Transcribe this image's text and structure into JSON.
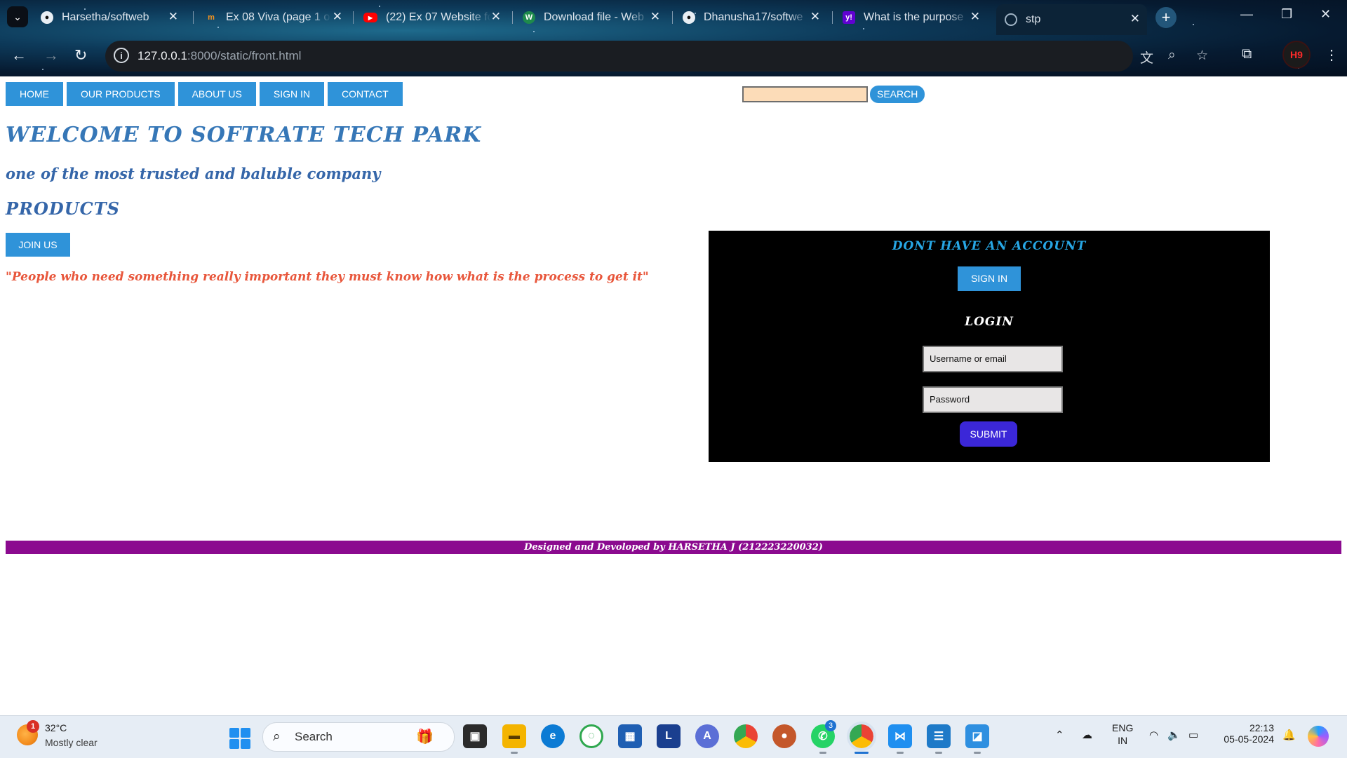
{
  "browser": {
    "tabs": [
      {
        "title": "Harsetha/softweb",
        "favicon": "github-icon",
        "active": false
      },
      {
        "title": "Ex 08 Viva (page 1 of",
        "favicon": "moodle-icon",
        "active": false
      },
      {
        "title": "(22) Ex 07 Website fo",
        "favicon": "youtube-icon",
        "active": false
      },
      {
        "title": "Download file - Web",
        "favicon": "w-icon",
        "active": false
      },
      {
        "title": "Dhanusha17/softwe",
        "favicon": "github-icon",
        "active": false
      },
      {
        "title": "What is the purpose",
        "favicon": "yahoo-icon",
        "active": false
      },
      {
        "title": "stp",
        "favicon": "globe-icon",
        "active": true
      }
    ],
    "url_host": "127.0.0.1",
    "url_rest": ":8000/static/front.html",
    "profile_initials": "H9"
  },
  "page": {
    "nav": [
      "HOME",
      "OUR PRODUCTS",
      "ABOUT US",
      "SIGN IN",
      "CONTACT"
    ],
    "search_button": "SEARCH",
    "title": "WELCOME TO SOFTRATE TECH PARK",
    "subtitle": "one of the most trusted and baluble company",
    "products_heading": "PRODUCTS",
    "join_button": "JOIN US",
    "quote": "\"People who need something really important they must know how what is the process to get it\"",
    "account_panel": {
      "heading": "DONT HAVE AN ACCOUNT",
      "signin_button": "SIGN IN",
      "login_heading": "LOGIN",
      "username_placeholder": "Username or email",
      "password_placeholder": "Password",
      "submit_button": "SUBMIT"
    },
    "footer": "Designed and Devoloped by HARSETHA J (212223220032)"
  },
  "taskbar": {
    "weather_temp": "32°C",
    "weather_condition": "Mostly clear",
    "weather_badge": "1",
    "search_label": "Search",
    "whatsapp_badge": "3",
    "language_line1": "ENG",
    "language_line2": "IN",
    "time": "22:13",
    "date": "05-05-2024"
  },
  "colors": {
    "nav_button": "#2f93d9",
    "heading_blue": "#3677b7",
    "quote_red": "#e8563b",
    "submit_purple": "#3b27d8",
    "footer_purple": "#8b0a8f",
    "search_input_bg": "#fcdcb8"
  }
}
